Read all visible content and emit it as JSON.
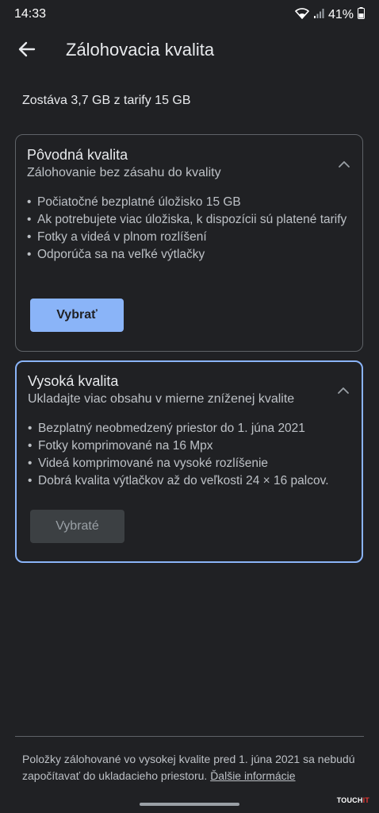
{
  "status_bar": {
    "time": "14:33",
    "battery": "41%",
    "icons": [
      "wifi-icon",
      "signal-icon",
      "battery-icon"
    ]
  },
  "app_bar": {
    "title": "Zálohovacia kvalita",
    "back_icon": "arrow-back-icon"
  },
  "storage": {
    "text": "Zostáva 3,7 GB z tarify 15 GB"
  },
  "cards": [
    {
      "title": "Pôvodná kvalita",
      "subtitle": "Zálohovanie bez zásahu do kvality",
      "bullets": [
        "Počiatočné bezplatné úložisko 15 GB",
        "Ak potrebujete viac úložiska, k dispozícii sú platené tarify",
        "Fotky a videá v plnom rozlíšení",
        "Odporúča sa na veľké výtlačky"
      ],
      "button_label": "Vybrať",
      "selected": false
    },
    {
      "title": "Vysoká kvalita",
      "subtitle": "Ukladajte viac obsahu v mierne zníženej kvalite",
      "bullets": [
        "Bezplatný neobmedzený priestor do 1. júna 2021",
        "Fotky komprimované na 16 Mpx",
        "Videá komprimované na vysoké rozlíšenie",
        "Dobrá kvalita výtlačkov až do veľkosti 24 × 16 palcov."
      ],
      "button_label": "Vybraté",
      "selected": true
    }
  ],
  "footer": {
    "text": "Položky zálohované vo vysokej kvalite pred 1. júna 2021 sa nebudú započítavať do ukladacieho priestoru.",
    "link": "Ďalšie informácie"
  },
  "watermark": {
    "main": "TOUCH",
    "accent": "IT"
  },
  "colors": {
    "background": "#202124",
    "accent": "#8ab4f8",
    "card_border": "#5f6368"
  }
}
